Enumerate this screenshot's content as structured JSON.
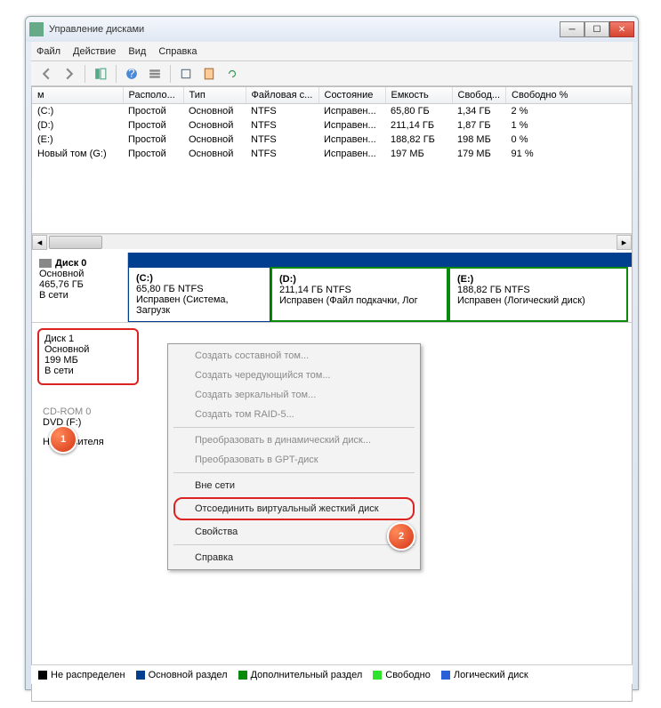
{
  "window": {
    "title": "Управление дисками"
  },
  "menus": {
    "file": "Файл",
    "action": "Действие",
    "view": "Вид",
    "help": "Справка"
  },
  "table": {
    "headers": [
      "м",
      "Располо...",
      "Тип",
      "Файловая с...",
      "Состояние",
      "Емкость",
      "Свобод...",
      "Свободно %"
    ],
    "rows": [
      [
        "(C:)",
        "Простой",
        "Основной",
        "NTFS",
        "Исправен...",
        "65,80 ГБ",
        "1,34 ГБ",
        "2 %"
      ],
      [
        "(D:)",
        "Простой",
        "Основной",
        "NTFS",
        "Исправен...",
        "211,14 ГБ",
        "1,87 ГБ",
        "1 %"
      ],
      [
        "(E:)",
        "Простой",
        "Основной",
        "NTFS",
        "Исправен...",
        "188,82 ГБ",
        "198 МБ",
        "0 %"
      ],
      [
        "Новый том (G:)",
        "Простой",
        "Основной",
        "NTFS",
        "Исправен...",
        "197 МБ",
        "179 МБ",
        "91 %"
      ]
    ]
  },
  "disk0": {
    "name": "Диск 0",
    "type": "Основной",
    "size": "465,76 ГБ",
    "status": "В сети",
    "parts": [
      {
        "name": "(C:)",
        "size": "65,80 ГБ NTFS",
        "state": "Исправен (Система, Загрузк"
      },
      {
        "name": "(D:)",
        "size": "211,14 ГБ NTFS",
        "state": "Исправен (Файл подкачки, Лог"
      },
      {
        "name": "(E:)",
        "size": "188,82 ГБ NTFS",
        "state": "Исправен (Логический диск)"
      }
    ]
  },
  "disk1": {
    "name": "Диск 1",
    "type": "Основной",
    "size": "199 МБ",
    "status": "В сети"
  },
  "cdrom": {
    "name": "CD-ROM 0",
    "drive": "DVD (F:)",
    "status": "Нет носителя"
  },
  "ctx": {
    "items": [
      "Создать составной том...",
      "Создать чередующийся том...",
      "Создать зеркальный том...",
      "Создать том RAID-5...",
      "Преобразовать в динамический диск...",
      "Преобразовать в GPT-диск",
      "Вне сети",
      "Отсоединить виртуальный жесткий диск",
      "Свойства",
      "Справка"
    ]
  },
  "legend": {
    "unalloc": "Не распределен",
    "primary": "Основной раздел",
    "extended": "Дополнительный раздел",
    "free": "Свободно",
    "logical": "Логический диск"
  },
  "callouts": {
    "one": "1",
    "two": "2"
  }
}
